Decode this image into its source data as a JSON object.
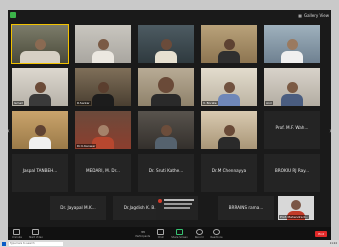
{
  "app": {
    "view_label": "Gallery View"
  },
  "participants": {
    "names": [
      "Ismail",
      "R.Sarkar",
      "V. Borate",
      "Anil",
      "Dr.K.Kanwar",
      "Prof. M.F. Wah...",
      "Jaspal TANBEH...",
      "MEDARI, M. Dr...",
      "Dr. Sruti Kathe...",
      "Dr.M Chennayya",
      "BROKIU RJ Ray...",
      "Dr. Jayapal M.K...",
      "Dr.Jagdish K. B...",
      "BRRAINS rama...",
      "Prof. Mahendra K..."
    ]
  },
  "toolbar": {
    "unmute": "Unmute",
    "start_video": "Start Video",
    "participants": "Participants",
    "participants_count": "33",
    "chat": "Chat",
    "share": "Share Screen",
    "record": "Record",
    "reactions": "Reactions",
    "end": "End"
  },
  "taskbar": {
    "search_placeholder": "Type here to search",
    "time": "11:24"
  }
}
